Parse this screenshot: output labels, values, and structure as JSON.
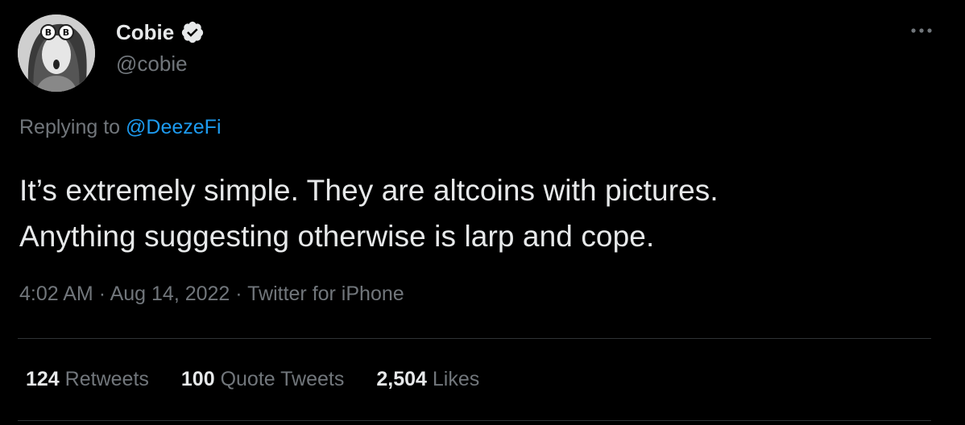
{
  "author": {
    "display_name": "Cobie",
    "handle": "@cobie",
    "verified": true,
    "avatar_icon": "profile-photo-avatar"
  },
  "more_icon": "more-options-icon",
  "reply": {
    "prefix": "Replying to",
    "mention": "@DeezeFi"
  },
  "text": {
    "line1": "It’s extremely simple. They are altcoins with pictures.",
    "line2": "Anything suggesting otherwise is larp and cope."
  },
  "meta": {
    "time": "4:02 AM",
    "separator1": "·",
    "date": "Aug 14, 2022",
    "separator2": "·",
    "source": "Twitter for iPhone"
  },
  "stats": [
    {
      "count": "124",
      "label": "Retweets"
    },
    {
      "count": "100",
      "label": "Quote Tweets"
    },
    {
      "count": "2,504",
      "label": "Likes"
    }
  ],
  "colors": {
    "background": "#000000",
    "primary_text": "#e7e9ea",
    "secondary_text": "#71767b",
    "link": "#1d9bf0",
    "divider": "#2f3336",
    "verified_badge": "#e7e9ea"
  }
}
